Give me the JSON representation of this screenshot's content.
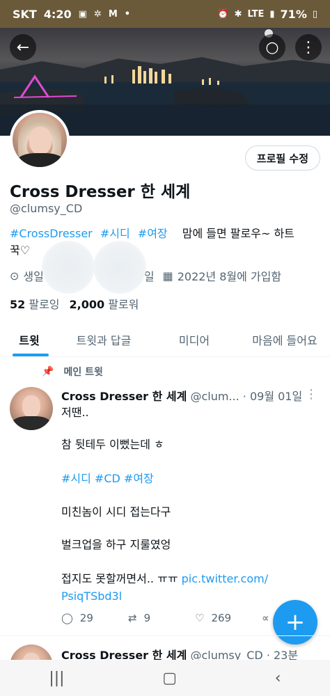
{
  "status": {
    "carrier": "SKT",
    "time": "4:20",
    "icons_left": [
      "image-icon",
      "fan-icon",
      "m-icon",
      "dot-icon"
    ],
    "network": "LTE",
    "battery": "71%"
  },
  "profile": {
    "name": "Cross Dresser 한 세계",
    "handle": "@clumsy_CD",
    "edit_label": "프로필 수정",
    "bio_tags": [
      "#CrossDresser",
      "#시디",
      "#여장"
    ],
    "bio_text_1": "맘에 들면 팔로우~ 하트",
    "bio_text_2": "꾹♡",
    "birthday_prefix": "생일",
    "birthday_suffix": "일",
    "joined": "2022년 8월에 가입함",
    "following_count": "52",
    "following_label": "팔로잉",
    "followers_count": "2,000",
    "followers_label": "팔로워"
  },
  "tabs": [
    "트윗",
    "트윗과 답글",
    "미디어",
    "마음에 들어요"
  ],
  "pinned_label": "메인 트윗",
  "tweet": {
    "name": "Cross Dresser 한 세계",
    "handle": "@clum...",
    "date": "· 09월 01일",
    "lines": [
      "저땐..",
      "참 뒷테두 이뻤는데 ㅎ",
      "#시디 #CD  #여장",
      "미친놈이 시디 접는다구",
      "벌크업을 하구 지룰였엉",
      "접지도 못할꺼면서.. ㅠㅠ",
      "pic.twitter.com/",
      "PsiqTSbd3l"
    ],
    "replies": "29",
    "retweets": "9",
    "likes": "269"
  },
  "tweet2": {
    "name": "Cross Dresser 한 세계",
    "handle": "@clumsy_CD",
    "date": "· 23분"
  },
  "colors": {
    "accent": "#1d9bf0",
    "text": "#0f1419",
    "muted": "#536471"
  }
}
